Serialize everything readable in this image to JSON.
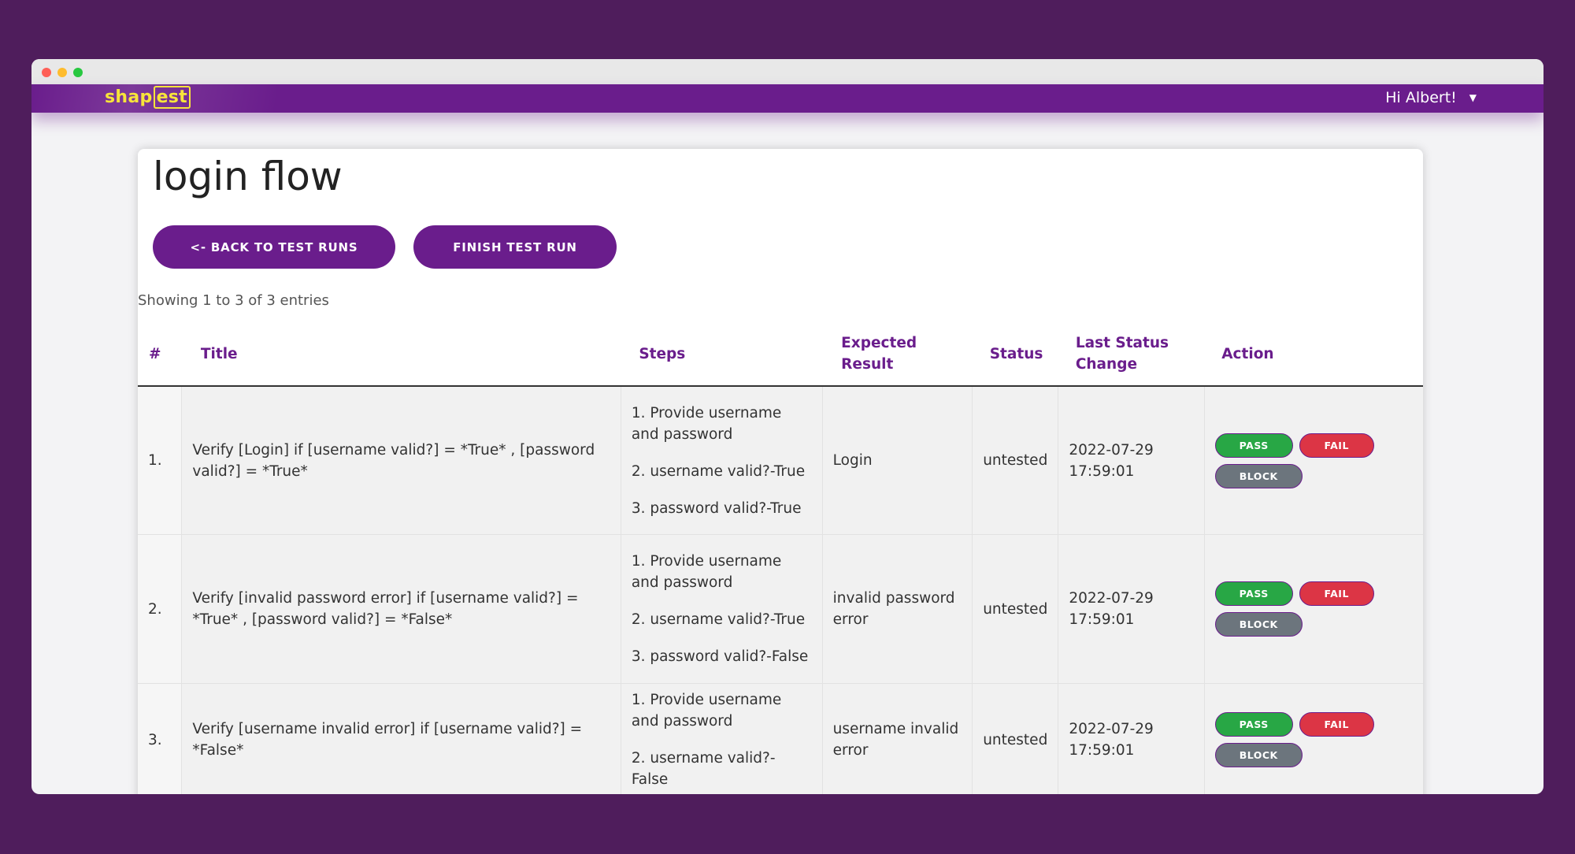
{
  "app": {
    "logo_prefix": "shap",
    "logo_boxed": "est",
    "user_greeting": "Hi Albert!",
    "caret": "▼"
  },
  "page": {
    "title": "login flow",
    "back_button": "<- BACK TO TEST RUNS",
    "finish_button": "FINISH TEST RUN",
    "showing_text": "Showing 1 to 3 of 3 entries"
  },
  "table": {
    "headers": [
      "#",
      "Title",
      "Steps",
      "Expected Result",
      "Status",
      "Last Status Change",
      "Action"
    ],
    "actions": {
      "pass": "PASS",
      "fail": "FAIL",
      "block": "BLOCK"
    },
    "rows": [
      {
        "num": "1.",
        "title": "Verify [Login] if [username valid?] = *True* , [password valid?] = *True*",
        "steps": [
          "1. Provide username and password",
          "2. username valid?-True",
          "3. password valid?-True"
        ],
        "expected": "Login",
        "status": "untested",
        "last_change": "2022-07-29 17:59:01"
      },
      {
        "num": "2.",
        "title": "Verify [invalid password error] if [username valid?] = *True* , [password valid?] = *False*",
        "steps": [
          "1. Provide username and password",
          "2. username valid?-True",
          "3. password valid?-False"
        ],
        "expected": "invalid password error",
        "status": "untested",
        "last_change": "2022-07-29 17:59:01"
      },
      {
        "num": "3.",
        "title": "Verify [username invalid error] if [username valid?] = *False*",
        "steps": [
          "1. Provide username and password",
          "2. username valid?-False"
        ],
        "expected": "username invalid error",
        "status": "untested",
        "last_change": "2022-07-29 17:59:01"
      }
    ]
  }
}
